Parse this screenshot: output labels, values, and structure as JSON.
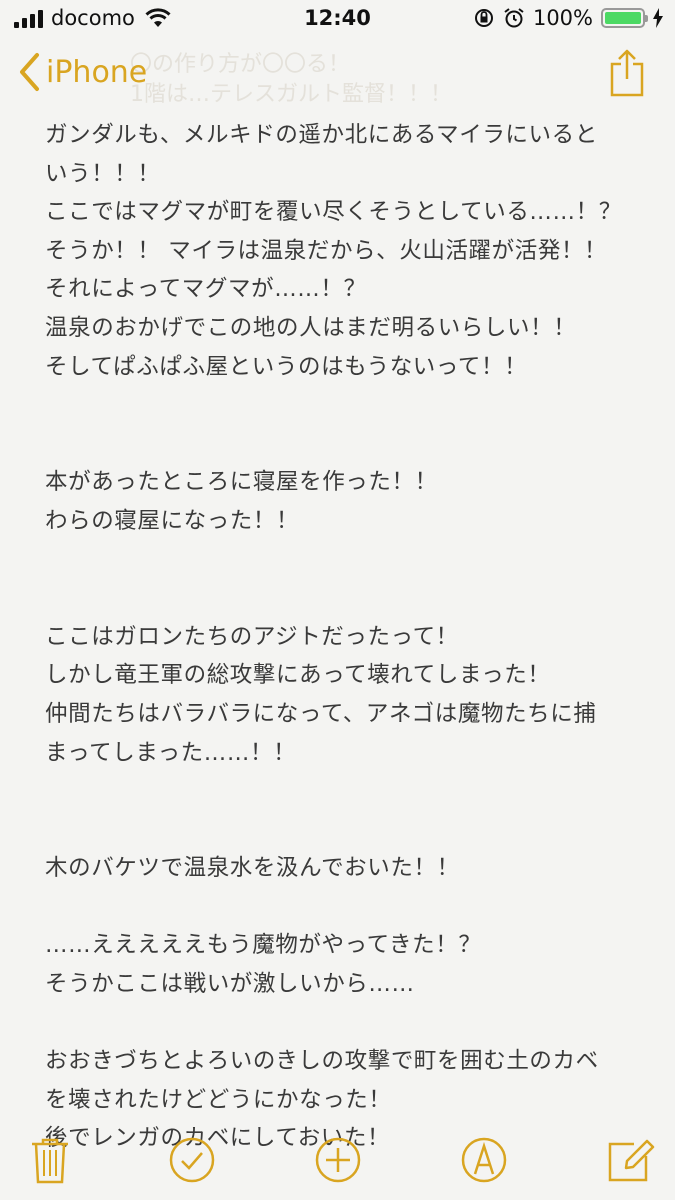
{
  "status_bar": {
    "carrier": "docomo",
    "time": "12:40",
    "battery": "100%"
  },
  "nav": {
    "back_label": "iPhone",
    "ghost_lines": [
      "〇の作り方が〇〇る！",
      "1階は…テレスガルト監督！！！"
    ]
  },
  "note": {
    "lines": [
      "ガンダルも、メルキドの遥か北にあるマイラにいると",
      "いう！！！",
      "ここではマグマが町を覆い尽くそうとしている……！？",
      "そうか！！ マイラは温泉だから、火山活躍が活発！！",
      "それによってマグマが……！？",
      "温泉のおかげでこの地の人はまだ明るいらしい！！",
      "そしてぱふぱふ屋というのはもうないって！！",
      "",
      "",
      "本があったところに寝屋を作った！！",
      "わらの寝屋になった！！",
      "",
      "",
      "ここはガロンたちのアジトだったって！",
      "しかし竜王軍の総攻撃にあって壊れてしまった！",
      "仲間たちはバラバラになって、アネゴは魔物たちに捕",
      "まってしまった……！！",
      "",
      "",
      "木のバケツで温泉水を汲んでおいた！！",
      "",
      "……えええええもう魔物がやってきた！？",
      "そうかここは戦いが激しいから……",
      "",
      "おおきづちとよろいのきしの攻撃で町を囲む土のカベ",
      "を壊されたけどどうにかなった！",
      "後でレンガのカベにしておいた！"
    ]
  },
  "toolbar": {
    "icons": [
      "trash-icon",
      "checklist-icon",
      "add-icon",
      "markup-icon",
      "compose-icon"
    ]
  },
  "colors": {
    "accent": "#d9a521",
    "background": "#f4f4f2",
    "text": "#3a3a3a",
    "battery": "#4cd964"
  }
}
